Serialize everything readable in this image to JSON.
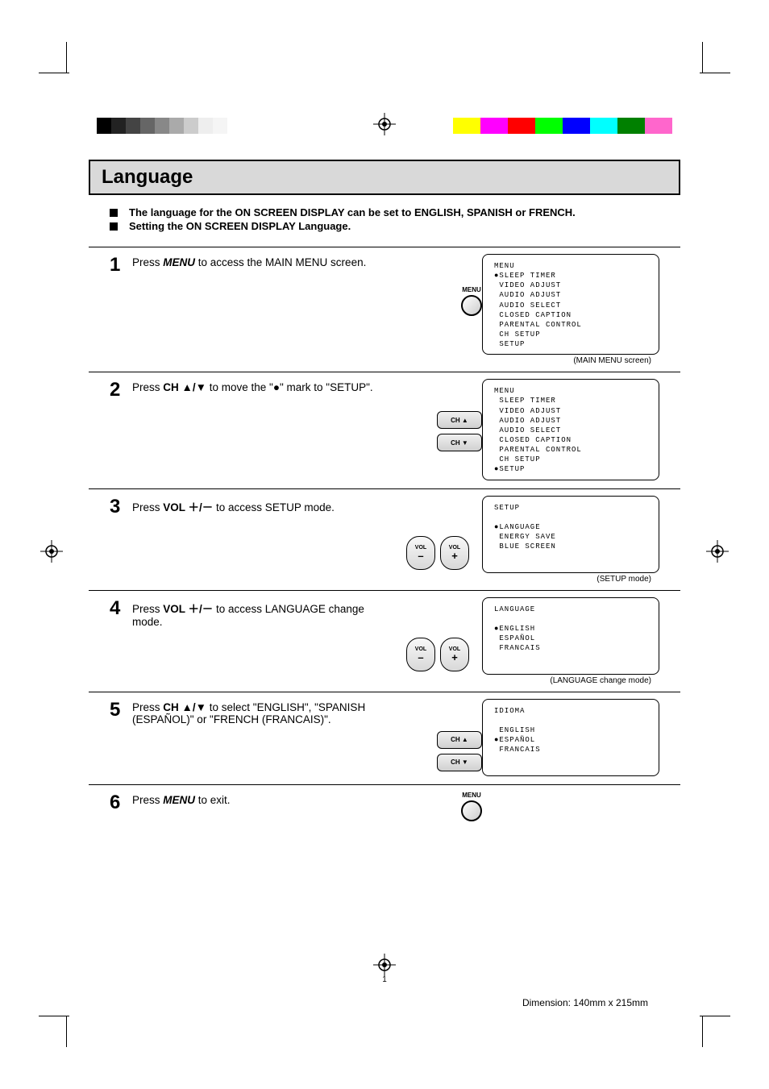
{
  "title": "Language",
  "intro": [
    "The language for the ON SCREEN DISPLAY can be set to ENGLISH, SPANISH or FRENCH.",
    "Setting the ON SCREEN DISPLAY Language."
  ],
  "steps": {
    "s1": {
      "num": "1",
      "text_pre": "Press ",
      "text_btn": "MENU",
      "text_post": " to access the MAIN MENU screen.",
      "screen_title": "MENU",
      "screen_items": [
        "SLEEP TIMER",
        "VIDEO ADJUST",
        "AUDIO ADJUST",
        "AUDIO SELECT",
        "CLOSED CAPTION",
        "PARENTAL CONTROL",
        "CH SETUP",
        "SETUP"
      ],
      "screen_mark_index": 0,
      "caption": "(MAIN MENU screen)",
      "control_label": "MENU"
    },
    "s2": {
      "num": "2",
      "text_pre": "Press  ",
      "text_btn": "CH ▲/▼",
      "text_post": "  to move the \"●\" mark to \"SETUP\".",
      "screen_title": "MENU",
      "screen_items": [
        "SLEEP TIMER",
        "VIDEO ADJUST",
        "AUDIO ADJUST",
        "AUDIO SELECT",
        "CLOSED CAPTION",
        "PARENTAL CONTROL",
        "CH SETUP",
        "SETUP"
      ],
      "screen_mark_index": 7,
      "ch_up": "CH ▲",
      "ch_dn": "CH ▼"
    },
    "s3": {
      "num": "3",
      "text_pre": "Press ",
      "text_btn": "VOL ＋/－",
      "text_post": " to access SETUP mode.",
      "screen_title": "SETUP",
      "screen_items": [
        "LANGUAGE",
        "ENERGY SAVE",
        "BLUE SCREEN"
      ],
      "screen_mark_index": 0,
      "caption": "(SETUP mode)",
      "vol_label": "VOL",
      "vol_minus": "–",
      "vol_plus": "+"
    },
    "s4": {
      "num": "4",
      "text_pre": "Press ",
      "text_btn": "VOL ＋/－",
      "text_post": "  to access LANGUAGE change mode.",
      "screen_title": "LANGUAGE",
      "screen_items": [
        "ENGLISH",
        "ESPAÑOL",
        "FRANCAIS"
      ],
      "screen_mark_index": 0,
      "caption": "(LANGUAGE change mode)",
      "vol_label": "VOL",
      "vol_minus": "–",
      "vol_plus": "+"
    },
    "s5": {
      "num": "5",
      "text_pre": "Press ",
      "text_btn": "CH ▲/▼",
      "text_post": "  to select \"ENGLISH\", \"SPANISH (ESPAÑOL)\" or \"FRENCH  (FRANCAIS)\".",
      "screen_title": "IDIOMA",
      "screen_items": [
        "ENGLISH",
        "ESPAÑOL",
        "FRANCAIS"
      ],
      "screen_mark_index": 1,
      "ch_up": "CH ▲",
      "ch_dn": "CH ▼"
    },
    "s6": {
      "num": "6",
      "text_pre": "Press ",
      "text_btn": "MENU",
      "text_post": " to exit.",
      "control_label": "MENU"
    }
  },
  "page_number": "1",
  "dimension": "Dimension: 140mm x 215mm",
  "colors_left": [
    "#000",
    "#222",
    "#444",
    "#666",
    "#888",
    "#aaa",
    "#ccc",
    "#eee",
    "#f5f5f5",
    "#fff"
  ],
  "colors_right": [
    "#ffff00",
    "#ff00ff",
    "#ff0000",
    "#00ff00",
    "#0000ff",
    "#00ffff",
    "#008000",
    "#ff66cc"
  ]
}
